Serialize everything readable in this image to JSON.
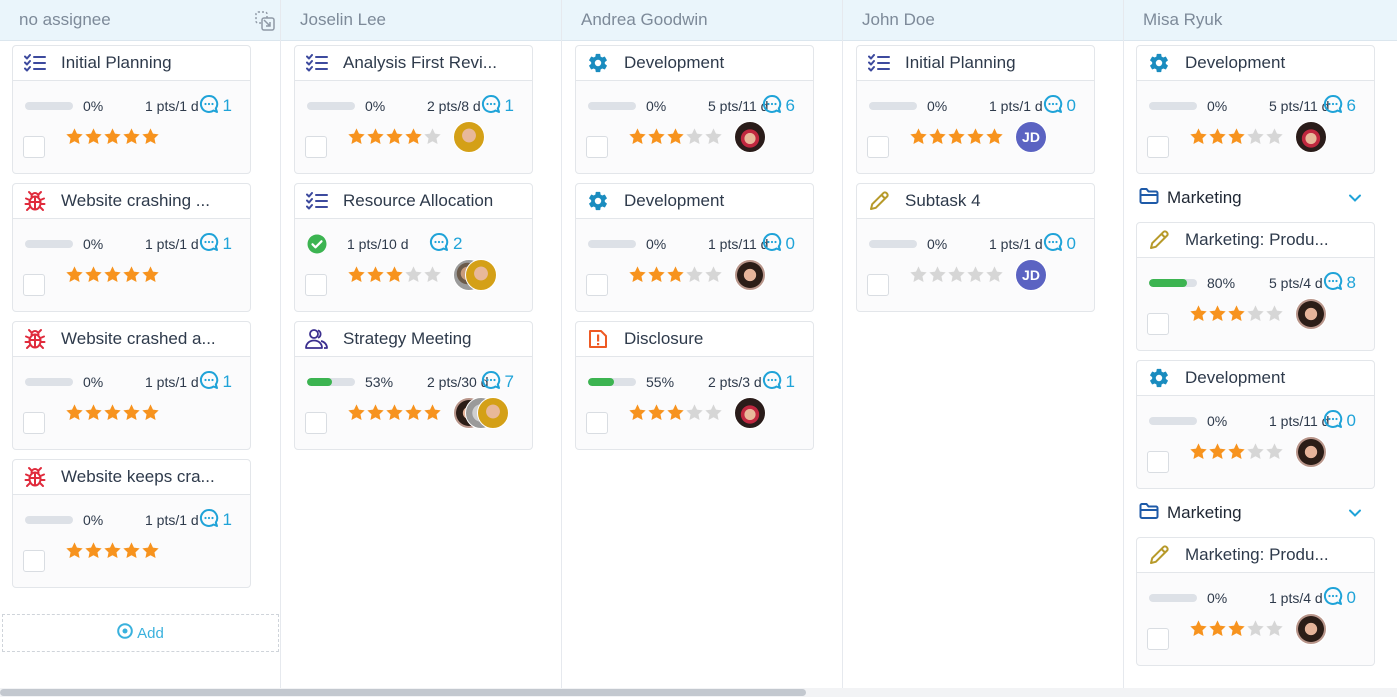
{
  "colors": {
    "header_bg": "#eaf5fb",
    "star_on": "#f7931e",
    "star_off": "#d6d6d6",
    "progress_fill": "#3cb451",
    "comment": "#1fa3d8",
    "checklist_icon": "#3d4a9e",
    "bug_icon": "#e02b3c",
    "gear_icon": "#1a8cbf",
    "pencil_icon": "#b79a2a",
    "alert_icon": "#ee5a24",
    "meeting_icon": "#3b2f8f",
    "folder_icon": "#1e5aa8",
    "initials_avatar": "#5b63c2"
  },
  "columns": [
    {
      "title": "no assignee",
      "header_icon": "move-to-icon",
      "add_label": "Add",
      "items": [
        {
          "kind": "card",
          "type": "checklist",
          "title": "Initial Planning",
          "progress": 0,
          "progress_label": "0%",
          "pts": "1 pts/1 d",
          "comments": "1",
          "rating": 5,
          "avatars": []
        },
        {
          "kind": "card",
          "type": "bug",
          "title": "Website crashing ...",
          "progress": 0,
          "progress_label": "0%",
          "pts": "1 pts/1 d",
          "comments": "1",
          "rating": 5,
          "avatars": []
        },
        {
          "kind": "card",
          "type": "bug",
          "title": "Website crashed a...",
          "progress": 0,
          "progress_label": "0%",
          "pts": "1 pts/1 d",
          "comments": "1",
          "rating": 5,
          "avatars": []
        },
        {
          "kind": "card",
          "type": "bug",
          "title": "Website keeps cra...",
          "progress": 0,
          "progress_label": "0%",
          "pts": "1 pts/1 d",
          "comments": "1",
          "rating": 5,
          "avatars": []
        }
      ]
    },
    {
      "title": "Joselin Lee",
      "items": [
        {
          "kind": "card",
          "type": "checklist",
          "title": "Analysis First Revi...",
          "progress": 0,
          "progress_label": "0%",
          "pts": "2 pts/8 d",
          "comments": "1",
          "rating": 4,
          "avatars": [
            {
              "photo": "yellow"
            }
          ]
        },
        {
          "kind": "card",
          "type": "checklist",
          "title": "Resource Allocation",
          "done": true,
          "pts": "1 pts/10 d",
          "comments": "2",
          "rating": 3,
          "avatars": [
            {
              "photo": "man"
            },
            {
              "photo": "yellow"
            }
          ]
        },
        {
          "kind": "card",
          "type": "meeting",
          "title": "Strategy Meeting",
          "progress": 53,
          "progress_label": "53%",
          "pts": "2 pts/30 d",
          "comments": "7",
          "rating": 5,
          "avatars": [
            {
              "photo": "asian"
            },
            {
              "photo": "grey"
            },
            {
              "photo": "yellow"
            }
          ]
        }
      ]
    },
    {
      "title": "Andrea Goodwin",
      "items": [
        {
          "kind": "card",
          "type": "gear",
          "title": "Development",
          "progress": 0,
          "progress_label": "0%",
          "pts": "5 pts/11 d",
          "comments": "6",
          "rating": 3,
          "avatars": [
            {
              "photo": "hat"
            }
          ]
        },
        {
          "kind": "card",
          "type": "gear",
          "title": "Development",
          "progress": 0,
          "progress_label": "0%",
          "pts": "1 pts/11 d",
          "comments": "0",
          "rating": 3,
          "avatars": [
            {
              "photo": "asian"
            }
          ]
        },
        {
          "kind": "card",
          "type": "alert",
          "title": "Disclosure",
          "progress": 55,
          "progress_label": "55%",
          "pts": "2 pts/3 d",
          "comments": "1",
          "rating": 3,
          "avatars": [
            {
              "photo": "hat"
            }
          ]
        }
      ]
    },
    {
      "title": "John Doe",
      "items": [
        {
          "kind": "card",
          "type": "checklist",
          "title": "Initial Planning",
          "progress": 0,
          "progress_label": "0%",
          "pts": "1 pts/1 d",
          "comments": "0",
          "rating": 5,
          "avatars": [
            {
              "initials": "JD"
            }
          ]
        },
        {
          "kind": "card",
          "type": "pencil",
          "title": "Subtask 4",
          "progress": 0,
          "progress_label": "0%",
          "pts": "1 pts/1 d",
          "comments": "0",
          "rating": 0,
          "avatars": [
            {
              "initials": "JD"
            }
          ]
        }
      ]
    },
    {
      "title": "Misa Ryuk",
      "items": [
        {
          "kind": "card",
          "type": "gear",
          "title": "Development",
          "progress": 0,
          "progress_label": "0%",
          "pts": "5 pts/11 d",
          "comments": "6",
          "rating": 3,
          "avatars": [
            {
              "photo": "hat"
            }
          ]
        },
        {
          "kind": "group",
          "title": "Marketing"
        },
        {
          "kind": "card",
          "type": "pencil",
          "title": "Marketing: Produ...",
          "progress": 80,
          "progress_label": "80%",
          "pts": "5 pts/4 d",
          "comments": "8",
          "rating": 3,
          "avatars": [
            {
              "photo": "asian"
            }
          ]
        },
        {
          "kind": "card",
          "type": "gear",
          "title": "Development",
          "progress": 0,
          "progress_label": "0%",
          "pts": "1 pts/11 d",
          "comments": "0",
          "rating": 3,
          "avatars": [
            {
              "photo": "asian"
            }
          ]
        },
        {
          "kind": "group",
          "title": "Marketing"
        },
        {
          "kind": "card",
          "type": "pencil",
          "title": "Marketing: Produ...",
          "progress": 0,
          "progress_label": "0%",
          "pts": "1 pts/4 d",
          "comments": "0",
          "rating": 3,
          "avatars": [
            {
              "photo": "asian"
            }
          ]
        }
      ]
    }
  ],
  "scrollbar": {
    "horizontal_position_fraction": 0.0,
    "visible_fraction": 0.58
  }
}
